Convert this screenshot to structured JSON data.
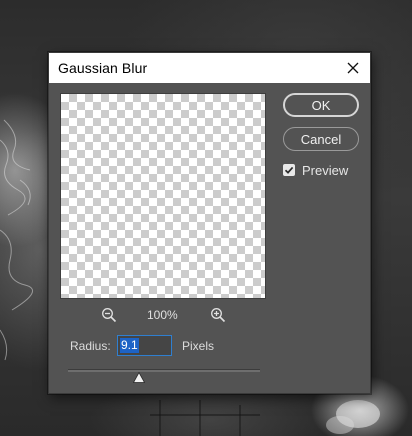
{
  "dialog": {
    "title": "Gaussian Blur",
    "close_icon": "close-icon"
  },
  "buttons": {
    "ok_label": "OK",
    "cancel_label": "Cancel"
  },
  "preview": {
    "label": "Preview",
    "checked": true
  },
  "zoom": {
    "level": "100%",
    "zoom_out_icon": "zoom-out-icon",
    "zoom_in_icon": "zoom-in-icon"
  },
  "radius": {
    "label": "Radius:",
    "value": "9.1",
    "units": "Pixels",
    "slider_fraction": 0.37
  },
  "colors": {
    "dialog_bg": "#535353",
    "titlebar_bg": "#ffffff",
    "input_focus_border": "#2f7fd0",
    "selection_bg": "#1d63c6"
  }
}
